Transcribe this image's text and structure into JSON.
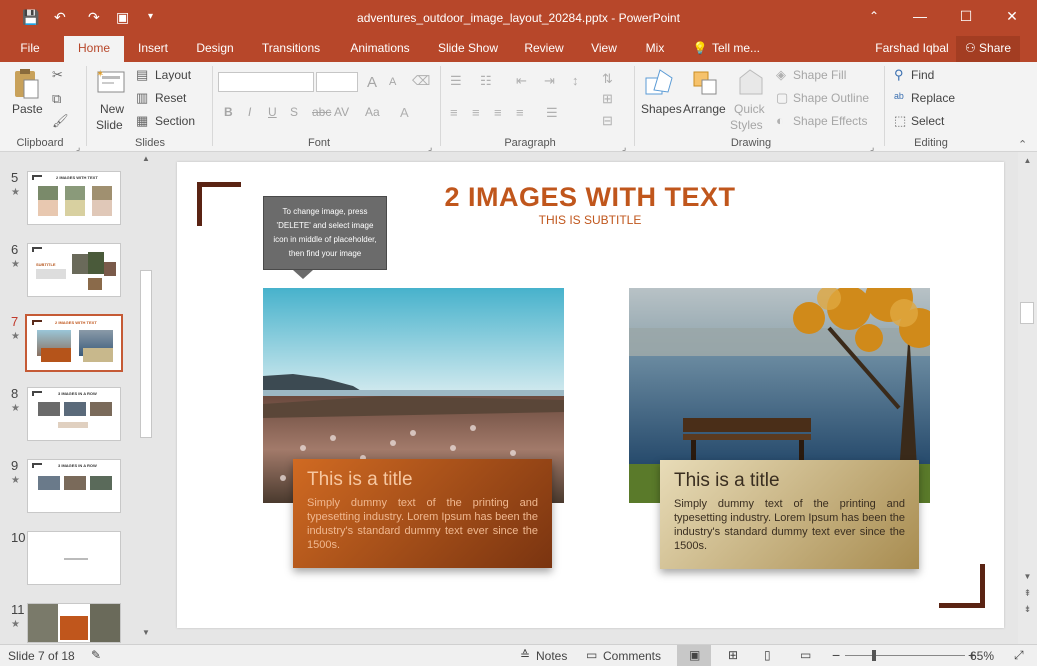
{
  "window": {
    "title": "adventures_outdoor_image_layout_20284.pptx - PowerPoint",
    "minimize": "—",
    "restore": "☐",
    "close": "✕",
    "ribbon_display": "⌃"
  },
  "qat": {
    "save": "💾",
    "undo": "↶",
    "redo": "↷",
    "present": "▣",
    "more": "▾"
  },
  "tabs": [
    "File",
    "Home",
    "Insert",
    "Design",
    "Transitions",
    "Animations",
    "Slide Show",
    "Review",
    "View",
    "Mix"
  ],
  "tell_me": "Tell me...",
  "user": "Farshad Iqbal",
  "share": "Share",
  "ribbon": {
    "clipboard": {
      "paste": "Paste",
      "label": "Clipboard"
    },
    "slides": {
      "new_slide_1": "New",
      "new_slide_2": "Slide",
      "layout": "Layout",
      "reset": "Reset",
      "section": "Section",
      "label": "Slides"
    },
    "font": {
      "label": "Font",
      "bold": "B",
      "italic": "I",
      "underline": "U",
      "strike": "S",
      "shadow": "abc",
      "spacing": "AV",
      "case": "Aa",
      "grow": "A",
      "shrink": "A"
    },
    "paragraph": {
      "label": "Paragraph"
    },
    "drawing": {
      "shapes": "Shapes",
      "arrange": "Arrange",
      "quick_1": "Quick",
      "quick_2": "Styles",
      "fill": "Shape Fill",
      "outline": "Shape Outline",
      "effects": "Shape Effects",
      "label": "Drawing"
    },
    "editing": {
      "find": "Find",
      "replace": "Replace",
      "select": "Select",
      "label": "Editing"
    }
  },
  "thumbnails": [
    {
      "num": "5",
      "star": "★",
      "title": "2 IMAGES WITH TEXT"
    },
    {
      "num": "6",
      "star": "★",
      "title": "SUBTITLE"
    },
    {
      "num": "7",
      "star": "★",
      "title": "2 IMAGES WITH TEXT"
    },
    {
      "num": "8",
      "star": "★",
      "title": "3 IMAGES IN A ROW"
    },
    {
      "num": "9",
      "star": "★",
      "title": "3 IMAGES IN A ROW"
    },
    {
      "num": "10",
      "star": ""
    },
    {
      "num": "11",
      "star": "★"
    }
  ],
  "slide": {
    "title": "2 IMAGES WITH TEXT",
    "subtitle": "THIS IS SUBTITLE",
    "callout": "To change image, press 'DELETE' and select image icon in middle of placeholder, then find your image",
    "card1": {
      "title": "This is a title",
      "body": "Simply dummy text of the printing and typesetting industry. Lorem Ipsum has been the industry's standard dummy text ever since the 1500s."
    },
    "card2": {
      "title": "This is a title",
      "body": "Simply dummy text of the printing and typesetting industry. Lorem Ipsum has been the industry's standard dummy text ever since the 1500s."
    }
  },
  "status": {
    "slide": "Slide 7 of 18",
    "notes": "Notes",
    "comments": "Comments",
    "zoom": "65%",
    "minus": "−",
    "plus": "+"
  },
  "colors": {
    "accent": "#b7472a",
    "title": "#c0561c",
    "card1": "#b5541a",
    "card2": "#c8b88c"
  }
}
